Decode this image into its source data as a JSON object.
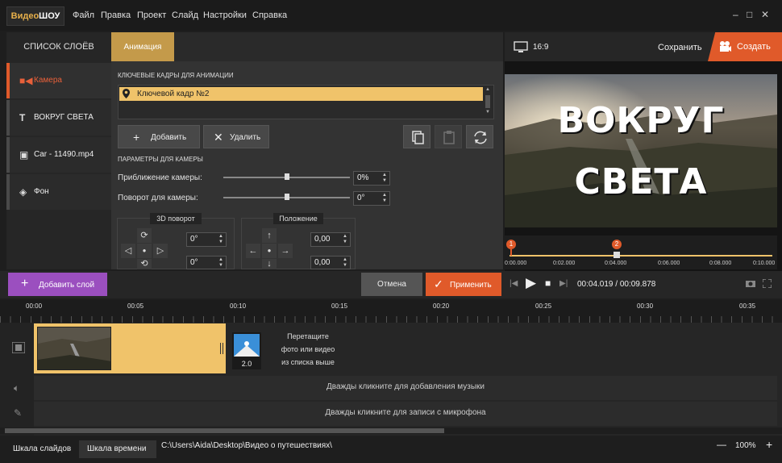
{
  "app": {
    "logo_part1": "Видео",
    "logo_part2": "ШОУ"
  },
  "menu": [
    "Файл",
    "Правка",
    "Проект",
    "Слайд",
    "Настройки",
    "Справка"
  ],
  "window": {
    "minimize": "–",
    "maximize": "□",
    "close": "✕"
  },
  "layers_panel": {
    "header": "СПИСОК СЛОЁВ",
    "items": [
      {
        "label": "Камера",
        "icon": "camera-icon"
      },
      {
        "label": "ВОКРУГ СВЕТА",
        "icon": "text-icon"
      },
      {
        "label": "Car - 11490.mp4",
        "icon": "video-icon"
      },
      {
        "label": "Фон",
        "icon": "fill-icon"
      }
    ]
  },
  "animation": {
    "tab": "Анимация",
    "keyframes_label": "КЛЮЧЕВЫЕ КАДРЫ ДЛЯ АНИМАЦИИ",
    "keyframe_item": "Ключевой кадр №2",
    "add_label": "Добавить",
    "delete_label": "Удалить",
    "camera_params_label": "ПАРАМЕТРЫ ДЛЯ КАМЕРЫ",
    "zoom_label": "Приближение камеры:",
    "zoom_value": "0%",
    "zoom_level": 0.5,
    "rotate_label": "Поворот для камеры:",
    "rotate_value": "0°",
    "rotate_level": 0.5,
    "rotation3d_title": "3D поворот",
    "rotation3d_values": [
      "0°",
      "0°"
    ],
    "position_title": "Положение",
    "position_values": [
      "0,00",
      "0,00"
    ]
  },
  "preview_header": {
    "aspect": "16:9",
    "save": "Сохранить",
    "create": "Создать"
  },
  "preview": {
    "line1": "ВОКРУГ",
    "line2": "СВЕТА"
  },
  "mini_timeline": {
    "markers": [
      "1",
      "2"
    ],
    "ticks": [
      "0:00.000",
      "0:02.000",
      "0:04.000",
      "0:06.000",
      "0:08.000",
      "0:10.000"
    ]
  },
  "actions": {
    "add_layer": "Добавить слой",
    "cancel": "Отмена",
    "apply": "Применить"
  },
  "playback": {
    "current": "00:04.019",
    "separator": " / ",
    "total": "00:09.878"
  },
  "timeline": {
    "ruler": [
      "00:00",
      "00:05",
      "00:10",
      "00:15",
      "00:20",
      "00:25",
      "00:30",
      "00:35"
    ],
    "transition_duration": "2.0",
    "drop_hint": [
      "Перетащите",
      "фото или видео",
      "из списка выше"
    ],
    "music_hint": "Дважды кликните для добавления музыки",
    "mic_hint": "Дважды кликните для записи с микрофона"
  },
  "status": {
    "tab_slides": "Шкала слайдов",
    "tab_timeline": "Шкала времени",
    "path": "C:\\Users\\Aida\\Desktop\\Видео о путешествиях\\",
    "zoom": "100%",
    "zoom_minus": "—",
    "zoom_plus": "+"
  },
  "colors": {
    "accent_orange": "#e05a2a",
    "accent_gold": "#c49a4a",
    "purple": "#9b4fbf",
    "keyframe": "#f0c36a"
  }
}
